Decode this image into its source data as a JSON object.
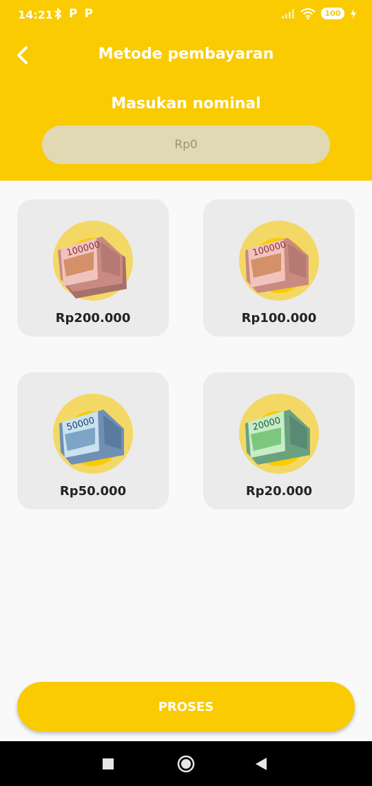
{
  "status_bar": {
    "time": "14:21",
    "battery": "100",
    "icons": [
      "bluetooth-icon",
      "p-icon",
      "p-icon",
      "signal-icon",
      "wifi-icon",
      "battery-icon",
      "charging-icon"
    ],
    "left_icon_letters": [
      "P",
      "P"
    ]
  },
  "header": {
    "title": "Metode pembayaran",
    "nominal_label": "Masukan nominal",
    "amount_placeholder": "Rp0",
    "back_icon": "back-arrow-icon"
  },
  "options": [
    {
      "label": "Rp200.000",
      "note": "100000",
      "color": "#c98a82"
    },
    {
      "label": "Rp100.000",
      "note": "100000",
      "color": "#c98a82"
    },
    {
      "label": "Rp50.000",
      "note": "50000",
      "color": "#6f8fb5"
    },
    {
      "label": "Rp20.000",
      "note": "20000",
      "color": "#6aa27f"
    }
  ],
  "actions": {
    "proses_label": "PROSES"
  },
  "colors": {
    "brand": "#f9cb00",
    "input_bg": "#e1d9b3",
    "card_bg": "#ebebeb"
  },
  "nav_bar": {
    "icons": [
      "recents-square-icon",
      "home-circle-icon",
      "back-triangle-icon"
    ]
  }
}
